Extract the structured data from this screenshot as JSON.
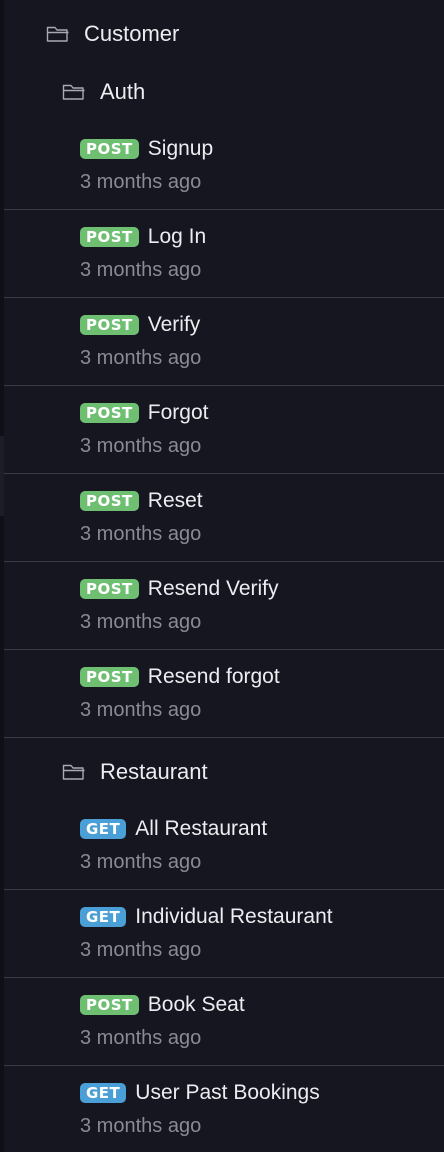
{
  "sidebar": {
    "root_folder": {
      "label": "Customer",
      "icon": "folder-open-icon"
    },
    "folders": [
      {
        "label": "Auth",
        "icon": "folder-open-icon",
        "requests": [
          {
            "method": "POST",
            "name": "Signup",
            "time": "3 months ago"
          },
          {
            "method": "POST",
            "name": "Log In",
            "time": "3 months ago"
          },
          {
            "method": "POST",
            "name": "Verify",
            "time": "3 months ago"
          },
          {
            "method": "POST",
            "name": "Forgot",
            "time": "3 months ago"
          },
          {
            "method": "POST",
            "name": "Reset",
            "time": "3 months ago"
          },
          {
            "method": "POST",
            "name": "Resend Verify",
            "time": "3 months ago"
          },
          {
            "method": "POST",
            "name": "Resend forgot",
            "time": "3 months ago"
          }
        ]
      },
      {
        "label": "Restaurant",
        "icon": "folder-open-icon",
        "requests": [
          {
            "method": "GET",
            "name": "All Restaurant",
            "time": "3 months ago"
          },
          {
            "method": "GET",
            "name": "Individual Restaurant",
            "time": "3 months ago"
          },
          {
            "method": "POST",
            "name": "Book Seat",
            "time": "3 months ago"
          },
          {
            "method": "GET",
            "name": "User Past Bookings",
            "time": "3 months ago"
          }
        ]
      }
    ]
  },
  "colors": {
    "background": "#161620",
    "post_badge": "#6fbf73",
    "get_badge": "#4a9fd6",
    "text": "#ececf1",
    "muted_text": "#8a8a96",
    "divider": "#3a3a44"
  }
}
